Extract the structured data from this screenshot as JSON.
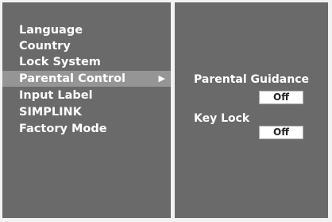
{
  "menu": {
    "items": [
      {
        "label": "Language"
      },
      {
        "label": "Country"
      },
      {
        "label": "Lock System"
      },
      {
        "label": "Parental Control",
        "selected": true,
        "arrow": "▶"
      },
      {
        "label": "Input Label"
      },
      {
        "label": "SIMPLINK"
      },
      {
        "label": "Factory Mode"
      }
    ]
  },
  "submenu": {
    "options": [
      {
        "label": "Parental Guidance",
        "value": "Off"
      },
      {
        "label": "Key Lock",
        "value": "Off"
      }
    ]
  },
  "colors": {
    "panel": "#6a6a6a",
    "highlight": "#959595",
    "text": "#ffffff"
  },
  "icons": {
    "submenu_arrow": "triangle-right-icon"
  }
}
